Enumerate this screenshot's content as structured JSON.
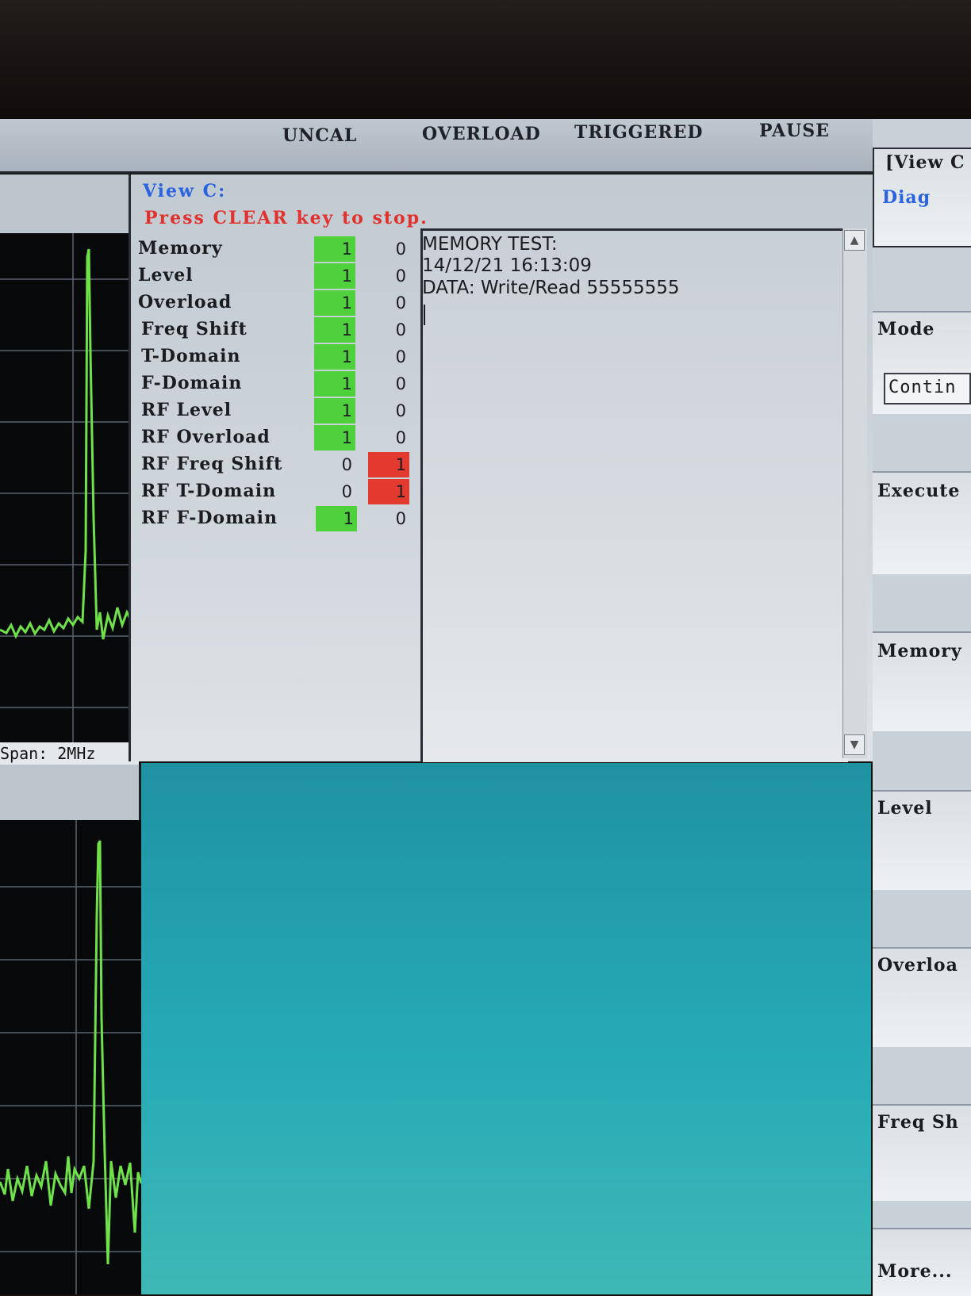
{
  "status_bar": {
    "uncal": "UNCAL",
    "overload": "OVERLOAD",
    "triggered": "TRIGGERED",
    "pause": "PAUSE"
  },
  "left_panel": {
    "span_label": "Span: 2MHz"
  },
  "diag": {
    "view_label": "View C:",
    "hint": "Press CLEAR key to stop.",
    "tests": [
      {
        "name": "Memory",
        "pass": "1",
        "fail": "0",
        "status": "pass"
      },
      {
        "name": "Level",
        "pass": "1",
        "fail": "0",
        "status": "pass"
      },
      {
        "name": "Overload",
        "pass": "1",
        "fail": "0",
        "status": "pass"
      },
      {
        "name": "Freq Shift",
        "pass": "1",
        "fail": "0",
        "status": "pass"
      },
      {
        "name": "T-Domain",
        "pass": "1",
        "fail": "0",
        "status": "pass"
      },
      {
        "name": "F-Domain",
        "pass": "1",
        "fail": "0",
        "status": "pass"
      },
      {
        "name": "RF Level",
        "pass": "1",
        "fail": "0",
        "status": "pass"
      },
      {
        "name": "RF Overload",
        "pass": "1",
        "fail": "0",
        "status": "pass"
      },
      {
        "name": "RF Freq Shift",
        "pass": "0",
        "fail": "1",
        "status": "fail"
      },
      {
        "name": "RF T-Domain",
        "pass": "0",
        "fail": "1",
        "status": "fail"
      },
      {
        "name": "RF F-Domain",
        "pass": "1",
        "fail": "0",
        "status": "pass"
      }
    ],
    "log": {
      "line1": "MEMORY TEST:",
      "line2": "14/12/21 16:13:09",
      "line3": "DATA: Write/Read 55555555"
    }
  },
  "softkeys": {
    "view": "[View C",
    "diag": "Diag",
    "mode": "Mode",
    "mode_value": "Contin",
    "execute": "Execute",
    "memory": "Memory",
    "level": "Level",
    "overload": "Overloa",
    "freq_shift": "Freq Sh",
    "more": "More..."
  },
  "colors": {
    "pass": "#4fd13e",
    "fail": "#e23a2e",
    "trace": "#6fe24a",
    "view_label": "#2a62e0",
    "hint": "#e2302c",
    "cyan": "#26aab6"
  }
}
